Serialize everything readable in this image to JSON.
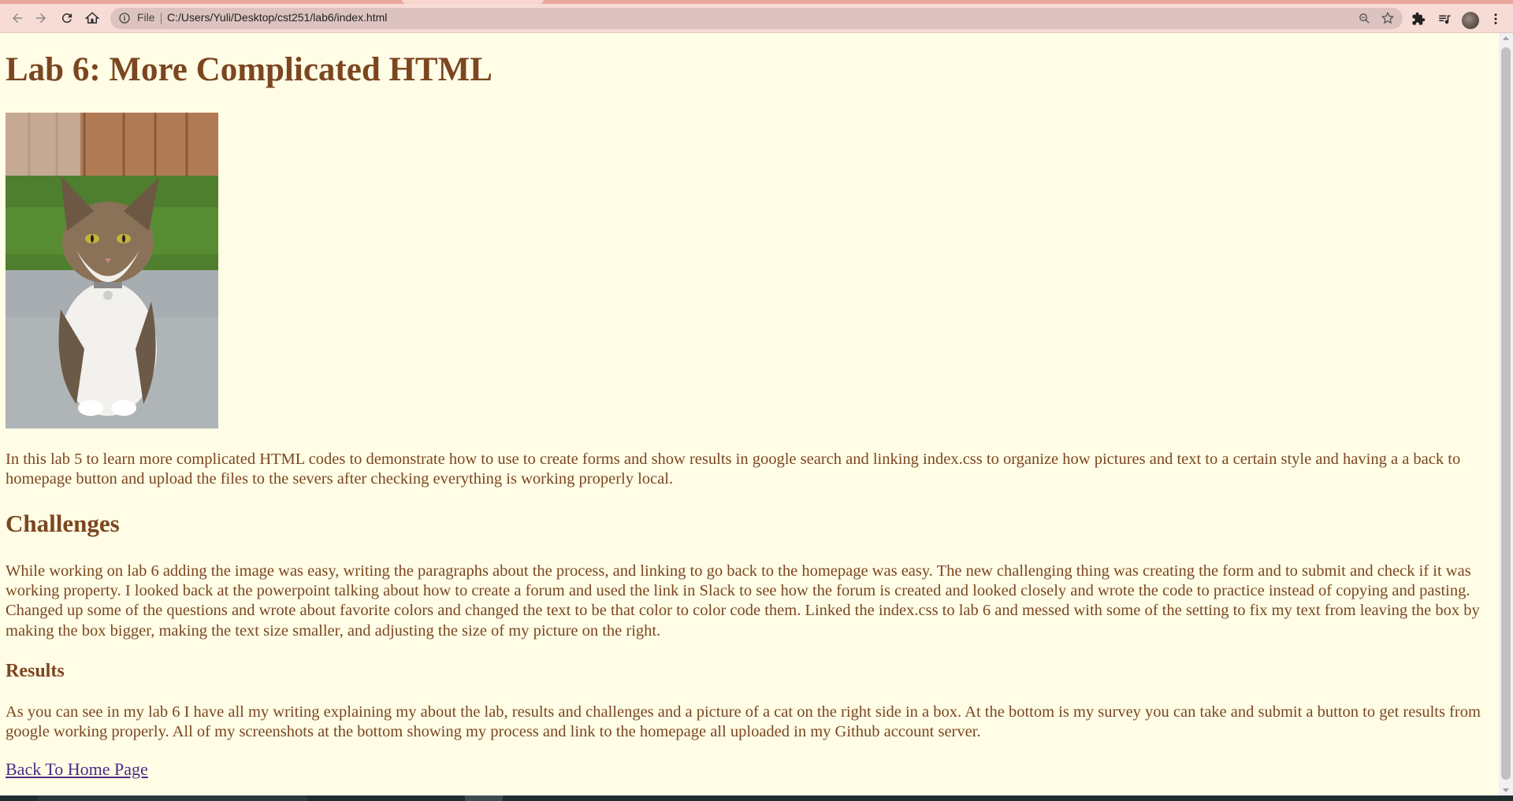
{
  "browser": {
    "url_scheme_label": "File",
    "url": "C:/Users/Yuli/Desktop/cst251/lab6/index.html",
    "icons": [
      "back-icon",
      "forward-icon",
      "reload-icon",
      "home-icon",
      "info-icon",
      "zoom-icon",
      "star-icon",
      "extensions-icon",
      "media-icon",
      "avatar",
      "menu-icon"
    ]
  },
  "page": {
    "title": "Lab 6: More Complicated HTML",
    "intro": "In this lab 5 to learn more complicated HTML codes to demonstrate how to use to create forms and show results in google search and linking index.css to organize how pictures and text to a certain style and having a a back to homepage button and upload the files to the severs after checking everything is working properly local.",
    "challenges_heading": "Challenges",
    "challenges_text": "While working on lab 6 adding the image was easy, writing the paragraphs about the process, and linking to go back to the homepage was easy. The new challenging thing was creating the form and to submit and check if it was working property. I looked back at the powerpoint talking about how to create a forum and used the link in Slack to see how the forum is created and looked closely and wrote the code to practice instead of copying and pasting. Changed up some of the questions and wrote about favorite colors and changed the text to be that color to color code them. Linked the index.css to lab 6 and messed with some of the setting to fix my text from leaving the box by making the box bigger, making the text size smaller, and adjusting the size of my picture on the right.",
    "results_heading": "Results",
    "results_text": "As you can see in my lab 6 I have all my writing explaining my about the lab, results and challenges and a picture of a cat on the right side in a box. At the bottom is my survey you can take and submit a button to get results from google working properly. All of my screenshots at the bottom showing my process and link to the homepage all uploaded in my Github account server.",
    "home_link": "Back To Home Page"
  },
  "colors": {
    "background": "#fffde6",
    "text": "#7b4620",
    "link": "#4b2b86",
    "chrome": "#f7dbd5"
  }
}
